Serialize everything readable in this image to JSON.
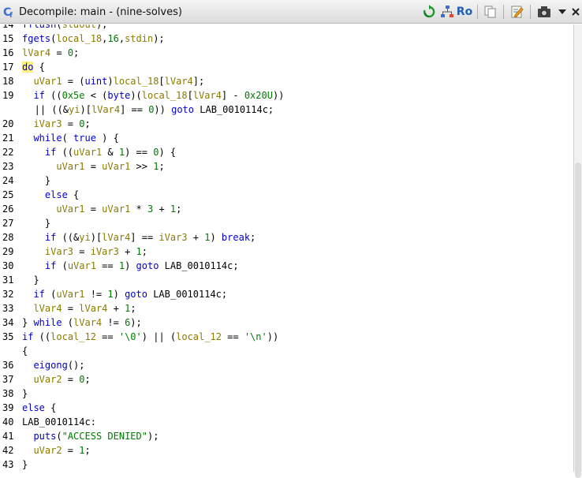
{
  "window": {
    "title": "Decompile: main - (nine-solves)"
  },
  "toolbar": {
    "ro_label": "Ro",
    "buttons": [
      "refresh-icon",
      "graph-icon",
      "ro-icon",
      "copy-icon",
      "edit-icon",
      "snapshot-icon",
      "menu-arrow-icon",
      "close-icon"
    ]
  },
  "code": {
    "lines": [
      {
        "n": "14",
        "t": "fflush(stdout);"
      },
      {
        "n": "15",
        "t": "fgets(local_18,16,stdin);"
      },
      {
        "n": "16",
        "t": "lVar4 = 0;"
      },
      {
        "n": "17",
        "t": "do {"
      },
      {
        "n": "18",
        "t": "  uVar1 = (uint)local_18[lVar4];"
      },
      {
        "n": "19",
        "t": "  if ((0x5e < (byte)(local_18[lVar4] - 0x20U))"
      },
      {
        "n": "",
        "t": "   || ((&yi)[lVar4] == 0)) goto LAB_0010114c;"
      },
      {
        "n": "20",
        "t": "  iVar3 = 0;"
      },
      {
        "n": "21",
        "t": "  while( true ) {"
      },
      {
        "n": "22",
        "t": "    if ((uVar1 & 1) == 0) {"
      },
      {
        "n": "23",
        "t": "      uVar1 = uVar1 >> 1;"
      },
      {
        "n": "24",
        "t": "    }"
      },
      {
        "n": "25",
        "t": "    else {"
      },
      {
        "n": "26",
        "t": "      uVar1 = uVar1 * 3 + 1;"
      },
      {
        "n": "27",
        "t": "    }"
      },
      {
        "n": "28",
        "t": "    if ((&yi)[lVar4] == iVar3 + 1) break;"
      },
      {
        "n": "29",
        "t": "    iVar3 = iVar3 + 1;"
      },
      {
        "n": "30",
        "t": "    if (uVar1 == 1) goto LAB_0010114c;"
      },
      {
        "n": "31",
        "t": "  }"
      },
      {
        "n": "32",
        "t": "  if (uVar1 != 1) goto LAB_0010114c;"
      },
      {
        "n": "33",
        "t": "  lVar4 = lVar4 + 1;"
      },
      {
        "n": "34",
        "t": "} while (lVar4 != 6);"
      },
      {
        "n": "35",
        "t": "if ((local_12 == '\\0') || (local_12 == '\\n'))"
      },
      {
        "n": "",
        "t": "{"
      },
      {
        "n": "36",
        "t": "  eigong();"
      },
      {
        "n": "37",
        "t": "  uVar2 = 0;"
      },
      {
        "n": "38",
        "t": "}"
      },
      {
        "n": "39",
        "t": "else {"
      },
      {
        "n": "40",
        "t": "LAB_0010114c:"
      },
      {
        "n": "41",
        "t": "  puts(\"ACCESS DENIED\");"
      },
      {
        "n": "42",
        "t": "  uVar2 = 1;"
      },
      {
        "n": "43",
        "t": "}"
      }
    ]
  }
}
